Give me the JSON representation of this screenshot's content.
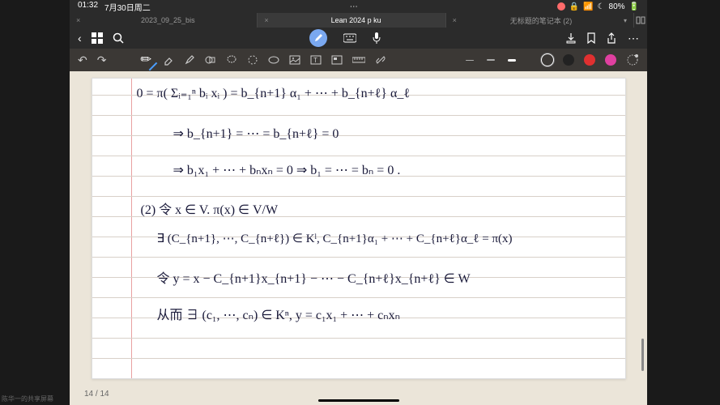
{
  "status": {
    "time": "01:32",
    "date": "7月30日周二",
    "battery": "80%"
  },
  "tabs": [
    {
      "label": "2023_09_25_bis",
      "active": false
    },
    {
      "label": "Lean 2024 p ku",
      "active": true
    },
    {
      "label": "无标题的笔记本 (2)",
      "active": false
    }
  ],
  "toolbar": {
    "strokes": [
      "thin",
      "med",
      "thick"
    ],
    "colors": {
      "blue": "#2965f0",
      "black": "#222",
      "red": "#e03030",
      "magenta": "#e040a0"
    }
  },
  "notes": {
    "l1": "0 = π( Σᵢ₌₁ⁿ bᵢ xᵢ )  =  b_{n+1} α₁ + ⋯ + b_{n+ℓ} α_ℓ",
    "l2": "⇒   b_{n+1} = ⋯ = b_{n+ℓ} = 0",
    "l3": "⇒   b₁x₁ + ⋯ + bₙxₙ = 0    ⇒   b₁ = ⋯ = bₙ = 0 .",
    "l4": "(2) 令  x ∈ V.     π(x) ∈ V/W",
    "l5": "∃ (C_{n+1}, ⋯, C_{n+ℓ}) ∈ Kˡ,    C_{n+1}α₁ + ⋯ + C_{n+ℓ}α_ℓ = π(x)",
    "l6": "令  y = x − C_{n+1}x_{n+1} − ⋯ − C_{n+ℓ}x_{n+ℓ}   ∈ W",
    "l7": "从而  ∃ (c₁, ⋯, cₙ) ∈ Kⁿ,   y = c₁x₁ + ⋯ + cₙxₙ"
  },
  "page": {
    "counter": "14 / 14"
  },
  "share_label": "陈华一的共享屏幕"
}
